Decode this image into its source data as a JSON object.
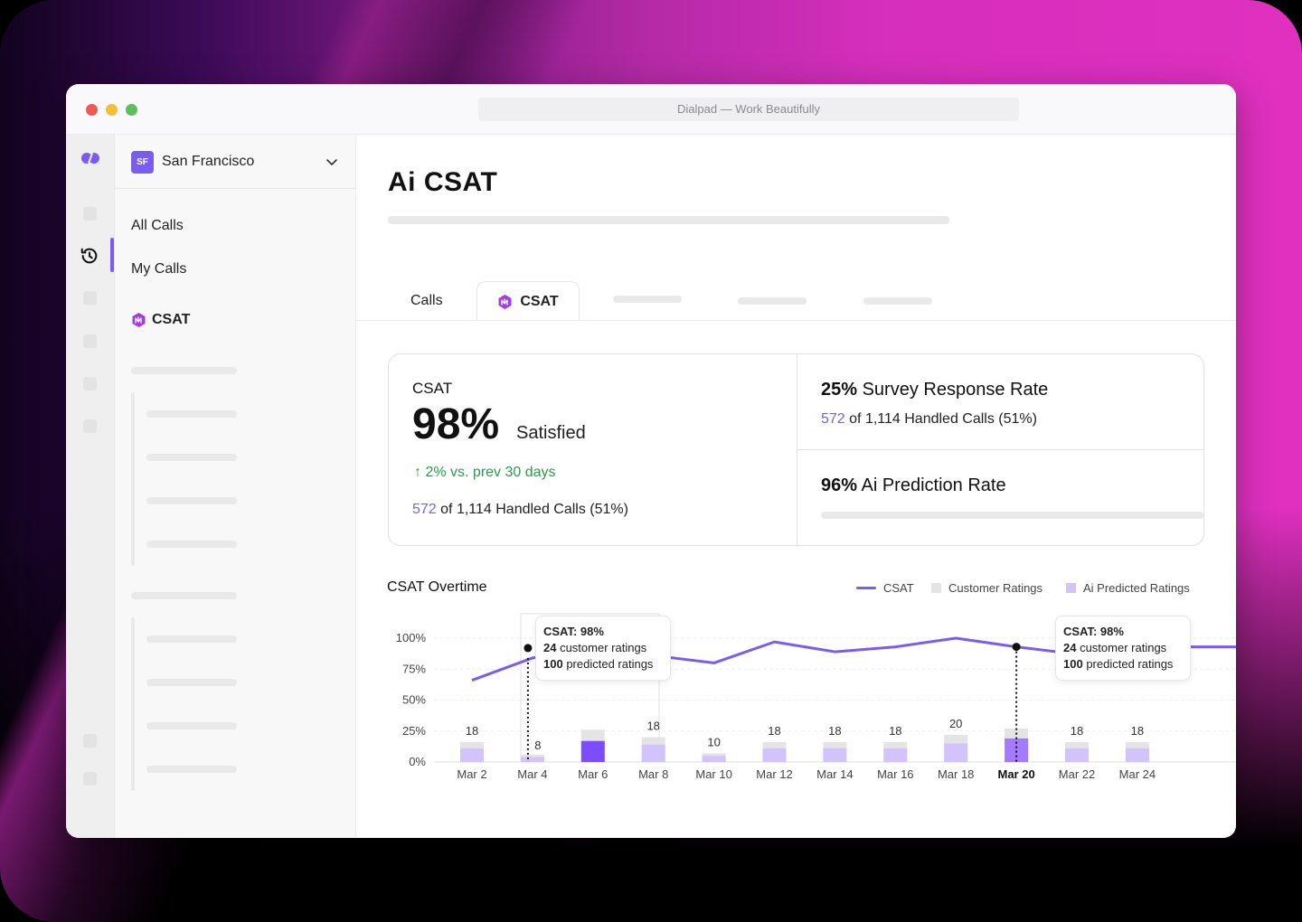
{
  "window": {
    "url_title": "Dialpad — Work Beautifully"
  },
  "org": {
    "initials": "SF",
    "name": "San Francisco"
  },
  "subnav": {
    "items": [
      {
        "label": "All Calls"
      },
      {
        "label": "My Calls"
      },
      {
        "label": "CSAT"
      }
    ]
  },
  "page": {
    "title": "Ai CSAT"
  },
  "tabs": [
    {
      "label": "Calls"
    },
    {
      "label": "CSAT"
    }
  ],
  "csat_card": {
    "label": "CSAT",
    "value": "98%",
    "value_suffix": "Satisfied",
    "trend": "2% vs. prev 30 days",
    "handled_count": "572",
    "handled_text": " of 1,114 Handled Calls (51%)"
  },
  "survey_card": {
    "value": "25%",
    "label": " Survey Response Rate",
    "handled_count": "572",
    "handled_text": " of 1,114 Handled Calls (51%)"
  },
  "prediction_card": {
    "value": "96%",
    "label": " Ai Prediction Rate"
  },
  "colors": {
    "accent": "#7c5cf0",
    "customer_ratings": "#e4e4e4",
    "ai_predicted": "#d2c3fb",
    "ai_predicted_active": "#7c4dff",
    "trend_up": "#2e9a4f"
  },
  "chart_data": {
    "type": "bar+line",
    "title": "CSAT Overtime",
    "legend": [
      "CSAT",
      "Customer Ratings",
      "Ai Predicted Ratings"
    ],
    "legend_position": "top-right",
    "categories": [
      "Mar 2",
      "Mar 4",
      "Mar 6",
      "Mar 8",
      "Mar 10",
      "Mar 12",
      "Mar 14",
      "Mar 16",
      "Mar 18",
      "Mar 20",
      "Mar 22",
      "Mar 24"
    ],
    "highlighted_category": "Mar 20",
    "y_ticks": [
      "0%",
      "25%",
      "50%",
      "75%",
      "100%"
    ],
    "ylim": [
      0,
      100
    ],
    "series": [
      {
        "name": "CSAT",
        "type": "line",
        "values": [
          66,
          84,
          90,
          86,
          80,
          97,
          89,
          93,
          100,
          93,
          87,
          93
        ]
      },
      {
        "name": "Customer Ratings",
        "type": "bar",
        "values": [
          16,
          6,
          26,
          20,
          7,
          16,
          16,
          16,
          22,
          27,
          16,
          16
        ]
      },
      {
        "name": "Ai Predicted Ratings",
        "type": "bar",
        "values": [
          11,
          4,
          17,
          14,
          5,
          11,
          11,
          11,
          15,
          19,
          11,
          11
        ]
      }
    ],
    "bar_labels": [
      "18",
      "8",
      "",
      "18",
      "10",
      "18",
      "18",
      "18",
      "20",
      "",
      "18",
      "18"
    ],
    "tooltips": [
      {
        "category": "Mar 4",
        "csat": "CSAT: 98%",
        "customer_count": "24",
        "customer_text": " customer ratings",
        "predicted_count": "100",
        "predicted_text": " predicted ratings"
      },
      {
        "category": "Mar 20",
        "csat": "CSAT: 98%",
        "customer_count": "24",
        "customer_text": " customer ratings",
        "predicted_count": "100",
        "predicted_text": " predicted ratings"
      }
    ]
  }
}
